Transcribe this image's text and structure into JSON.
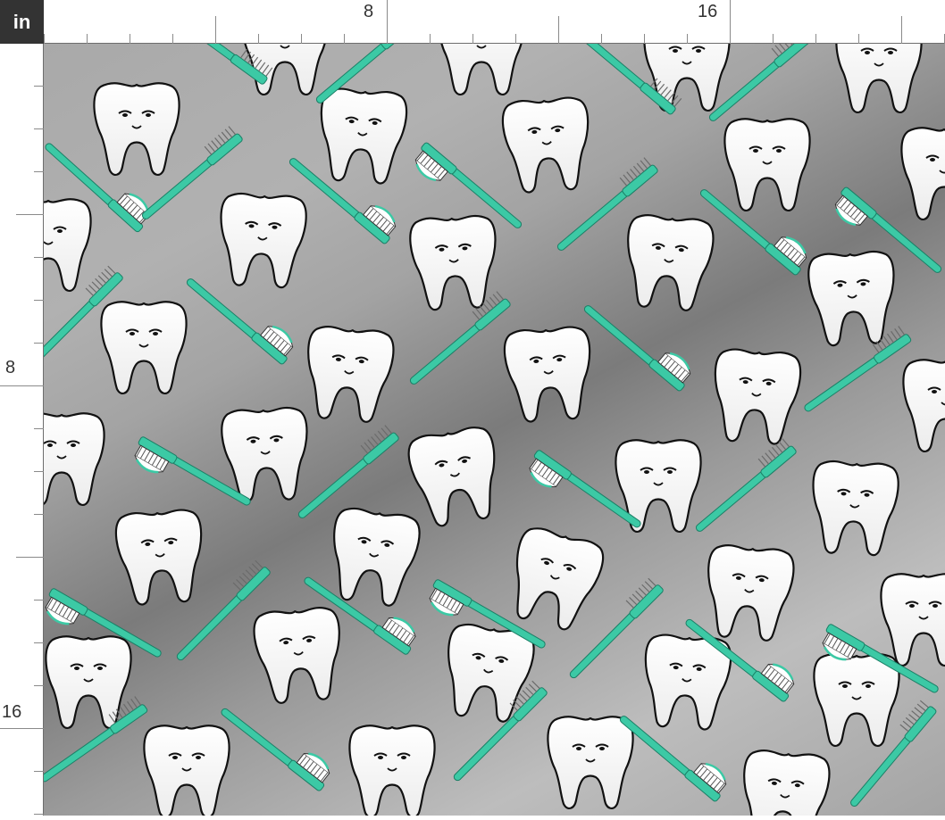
{
  "ruler": {
    "unit_label": "in",
    "top_labels": [
      "8",
      "16"
    ],
    "left_labels": [
      "8",
      "16"
    ]
  },
  "pattern": {
    "motifs": [
      "tooth-icon",
      "toothbrush-icon"
    ],
    "colors": {
      "background": "#a9a9a9",
      "tooth": "#ffffff",
      "outline": "#111111",
      "toothbrush": "#3cc9a5",
      "bristles": "#6b6b6b",
      "toothpaste_stripe": "#3cc9a5"
    }
  }
}
